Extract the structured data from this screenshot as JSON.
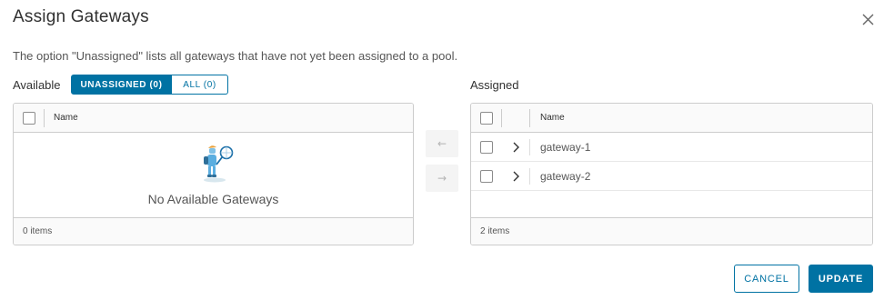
{
  "modal": {
    "title": "Assign Gateways",
    "description": "The option \"Unassigned\" lists all gateways that have not yet been assigned to a pool."
  },
  "available": {
    "label": "Available",
    "filter_unassigned": "UNASSIGNED (0)",
    "filter_all": "ALL (0)",
    "column_name": "Name",
    "empty_text": "No Available Gateways",
    "footer": "0 items"
  },
  "assigned": {
    "label": "Assigned",
    "column_name": "Name",
    "rows": [
      {
        "name": "gateway-1"
      },
      {
        "name": "gateway-2"
      }
    ],
    "footer": "2 items"
  },
  "transfer": {
    "left_arrow_icon": "arrow-left-icon",
    "right_arrow_icon": "arrow-right-icon",
    "left_glyph": "←",
    "right_glyph": "→"
  },
  "footer": {
    "cancel_label": "CANCEL",
    "update_label": "UPDATE"
  },
  "colors": {
    "primary": "#0072a3",
    "border": "#cccccc",
    "header_bg": "#fafafa"
  }
}
